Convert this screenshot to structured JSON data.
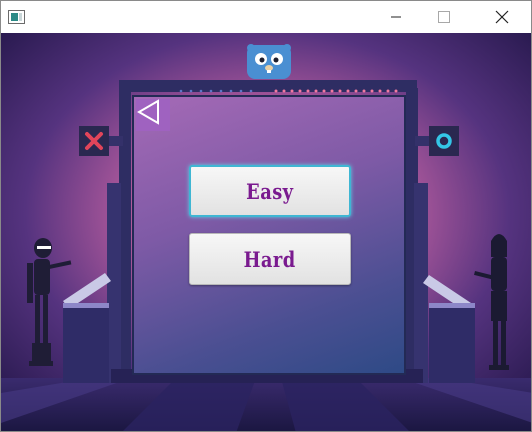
{
  "window": {
    "title": "",
    "controls": [
      "minimize-icon",
      "maximize-icon",
      "close-icon"
    ]
  },
  "menu": {
    "back_icon": "back-triangle-icon",
    "buttons": [
      {
        "label": "Easy",
        "focused": true
      },
      {
        "label": "Hard",
        "focused": false
      }
    ]
  },
  "scene": {
    "left_player_icon": "x-icon",
    "right_player_icon": "o-icon",
    "mascot": "gopher-icon",
    "colors": {
      "x_mark": "#e2455a",
      "o_mark": "#34c6e6",
      "button_text": "#7a1a8f",
      "focus_ring": "#3fb6d3"
    }
  }
}
